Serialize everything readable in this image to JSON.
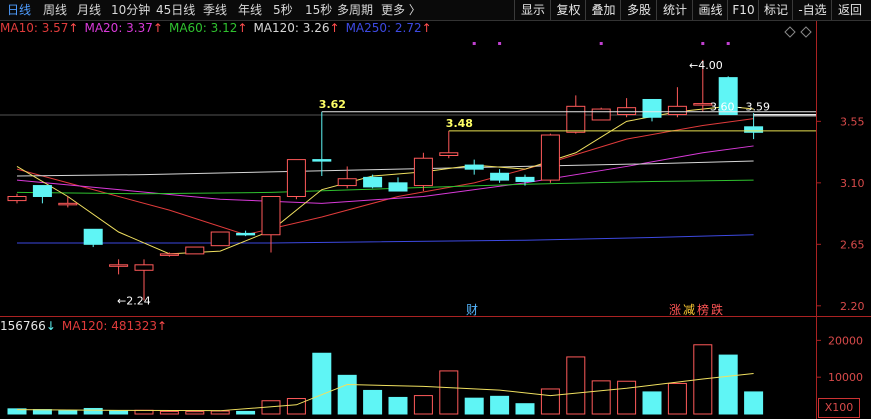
{
  "toolbar": {
    "periods": [
      {
        "label": "日线",
        "active": true
      },
      {
        "label": "周线",
        "active": false
      },
      {
        "label": "月线",
        "active": false
      },
      {
        "label": "10分钟",
        "active": false
      },
      {
        "label": "45日线",
        "active": false
      },
      {
        "label": "季线",
        "active": false
      },
      {
        "label": "年线",
        "active": false
      },
      {
        "label": "5秒",
        "active": false
      },
      {
        "label": "15秒",
        "active": false
      },
      {
        "label": "多周期",
        "active": false
      },
      {
        "label": "更多 〉",
        "active": false
      }
    ],
    "buttons": [
      "显示",
      "复权",
      "叠加",
      "多股",
      "统计",
      "画线",
      "F10",
      "标记",
      "-自选",
      "返回"
    ]
  },
  "ma_legend": [
    {
      "label": "MA10: 3.57",
      "color": "#e03b3b"
    },
    {
      "label": "MA20: 3.37",
      "color": "#d93ad9"
    },
    {
      "label": "MA60: 3.12",
      "color": "#2fc12f"
    },
    {
      "label": "MA120: 3.26",
      "color": "#d6d6d6"
    },
    {
      "label": "MA250: 2.72",
      "color": "#3d49e0"
    }
  ],
  "ma_legend_arrow": "↑",
  "vol_legend": [
    {
      "label": "156766",
      "color": "#e6e6e6",
      "arrow": "↓"
    },
    {
      "label": "MA120: 481323",
      "color": "#e03b3b",
      "arrow": "↑"
    }
  ],
  "price_axis": [
    {
      "value": "3.55",
      "price": 3.55
    },
    {
      "value": "3.10",
      "price": 3.1
    },
    {
      "value": "2.65",
      "price": 2.65
    },
    {
      "value": "2.20",
      "price": 2.2
    }
  ],
  "volume_axis": [
    {
      "value": "20000",
      "vol": 20000
    },
    {
      "value": "10000",
      "vol": 10000
    }
  ],
  "x100_label": "X100",
  "annotations": {
    "high": "4.00",
    "low": "2.24",
    "level_a": "3.62",
    "level_b": "3.48",
    "range": "3.60 - 3.59"
  },
  "badges": {
    "cai": "财",
    "items": [
      {
        "label": "涨",
        "color": "#ff5555"
      },
      {
        "label": "减",
        "color": "#ffcc33"
      },
      {
        "label": "榜",
        "color": "#ff5555"
      },
      {
        "label": "跌",
        "color": "#ff5555"
      }
    ]
  },
  "colors": {
    "up": "#ff5a5a",
    "down": "#5ff5f5",
    "ma5": "#f0e060"
  },
  "chart_data": {
    "type": "candlestick",
    "candles": [
      {
        "o": 2.97,
        "h": 3.02,
        "l": 2.95,
        "c": 3.0
      },
      {
        "o": 3.08,
        "h": 3.08,
        "l": 2.95,
        "c": 3.0
      },
      {
        "o": 2.95,
        "h": 3.0,
        "l": 2.92,
        "c": 2.95
      },
      {
        "o": 2.76,
        "h": 2.76,
        "l": 2.63,
        "c": 2.65
      },
      {
        "o": 2.5,
        "h": 2.54,
        "l": 2.43,
        "c": 2.5
      },
      {
        "o": 2.46,
        "h": 2.54,
        "l": 2.24,
        "c": 2.5
      },
      {
        "o": 2.58,
        "h": 2.59,
        "l": 2.56,
        "c": 2.58
      },
      {
        "o": 2.58,
        "h": 2.63,
        "l": 2.58,
        "c": 2.63
      },
      {
        "o": 2.64,
        "h": 2.74,
        "l": 2.64,
        "c": 2.74
      },
      {
        "o": 2.73,
        "h": 2.75,
        "l": 2.71,
        "c": 2.72
      },
      {
        "o": 2.72,
        "h": 3.0,
        "l": 2.59,
        "c": 3.0
      },
      {
        "o": 3.0,
        "h": 3.27,
        "l": 2.98,
        "c": 3.27
      },
      {
        "o": 3.27,
        "h": 3.62,
        "l": 3.15,
        "c": 3.26
      },
      {
        "o": 3.08,
        "h": 3.22,
        "l": 3.06,
        "c": 3.13
      },
      {
        "o": 3.14,
        "h": 3.16,
        "l": 3.06,
        "c": 3.07
      },
      {
        "o": 3.1,
        "h": 3.14,
        "l": 3.04,
        "c": 3.04
      },
      {
        "o": 3.08,
        "h": 3.32,
        "l": 3.04,
        "c": 3.28
      },
      {
        "o": 3.3,
        "h": 3.48,
        "l": 3.28,
        "c": 3.32
      },
      {
        "o": 3.23,
        "h": 3.27,
        "l": 3.16,
        "c": 3.2
      },
      {
        "o": 3.17,
        "h": 3.2,
        "l": 3.1,
        "c": 3.12
      },
      {
        "o": 3.14,
        "h": 3.16,
        "l": 3.08,
        "c": 3.11
      },
      {
        "o": 3.12,
        "h": 3.46,
        "l": 3.1,
        "c": 3.45
      },
      {
        "o": 3.47,
        "h": 3.74,
        "l": 3.46,
        "c": 3.66
      },
      {
        "o": 3.56,
        "h": 3.65,
        "l": 3.56,
        "c": 3.64
      },
      {
        "o": 3.6,
        "h": 3.72,
        "l": 3.58,
        "c": 3.65
      },
      {
        "o": 3.71,
        "h": 3.71,
        "l": 3.55,
        "c": 3.58
      },
      {
        "o": 3.6,
        "h": 3.8,
        "l": 3.58,
        "c": 3.66
      },
      {
        "o": 3.67,
        "h": 4.0,
        "l": 3.62,
        "c": 3.68
      },
      {
        "o": 3.87,
        "h": 3.88,
        "l": 3.6,
        "c": 3.6
      },
      {
        "o": 3.51,
        "h": 3.61,
        "l": 3.42,
        "c": 3.47
      }
    ],
    "volume": [
      {
        "v": 1400,
        "up": false
      },
      {
        "v": 1200,
        "up": false
      },
      {
        "v": 900,
        "up": false
      },
      {
        "v": 1500,
        "up": false
      },
      {
        "v": 900,
        "up": false
      },
      {
        "v": 1000,
        "up": true
      },
      {
        "v": 700,
        "up": true
      },
      {
        "v": 650,
        "up": true
      },
      {
        "v": 800,
        "up": true
      },
      {
        "v": 700,
        "up": false
      },
      {
        "v": 3600,
        "up": true
      },
      {
        "v": 4200,
        "up": true
      },
      {
        "v": 16500,
        "up": false
      },
      {
        "v": 10500,
        "up": false
      },
      {
        "v": 6400,
        "up": false
      },
      {
        "v": 4500,
        "up": false
      },
      {
        "v": 5000,
        "up": true
      },
      {
        "v": 11700,
        "up": true
      },
      {
        "v": 4300,
        "up": false
      },
      {
        "v": 4800,
        "up": false
      },
      {
        "v": 2800,
        "up": false
      },
      {
        "v": 6800,
        "up": true
      },
      {
        "v": 15500,
        "up": true
      },
      {
        "v": 9000,
        "up": true
      },
      {
        "v": 8900,
        "up": true
      },
      {
        "v": 6000,
        "up": false
      },
      {
        "v": 8300,
        "up": true
      },
      {
        "v": 18800,
        "up": true
      },
      {
        "v": 16000,
        "up": false
      },
      {
        "v": 6000,
        "up": false
      }
    ],
    "ma_lines": [
      {
        "name": "MA10",
        "color": "#e03b3b",
        "points": [
          [
            0,
            3.2
          ],
          [
            3,
            3.05
          ],
          [
            6,
            2.9
          ],
          [
            9,
            2.72
          ],
          [
            12,
            2.85
          ],
          [
            15,
            3.0
          ],
          [
            18,
            3.1
          ],
          [
            21,
            3.25
          ],
          [
            24,
            3.42
          ],
          [
            27,
            3.52
          ],
          [
            29,
            3.57
          ]
        ]
      },
      {
        "name": "MA20",
        "color": "#d93ad9",
        "points": [
          [
            0,
            3.12
          ],
          [
            4,
            3.05
          ],
          [
            8,
            2.98
          ],
          [
            12,
            2.95
          ],
          [
            16,
            3.0
          ],
          [
            20,
            3.1
          ],
          [
            24,
            3.22
          ],
          [
            27,
            3.32
          ],
          [
            29,
            3.37
          ]
        ]
      },
      {
        "name": "MA60",
        "color": "#2fc12f",
        "points": [
          [
            0,
            3.03
          ],
          [
            5,
            3.02
          ],
          [
            10,
            3.03
          ],
          [
            15,
            3.06
          ],
          [
            20,
            3.09
          ],
          [
            25,
            3.11
          ],
          [
            29,
            3.12
          ]
        ]
      },
      {
        "name": "MA120",
        "color": "#d6d6d6",
        "points": [
          [
            0,
            3.15
          ],
          [
            5,
            3.16
          ],
          [
            10,
            3.18
          ],
          [
            15,
            3.2
          ],
          [
            20,
            3.22
          ],
          [
            25,
            3.24
          ],
          [
            29,
            3.26
          ]
        ]
      },
      {
        "name": "MA250",
        "color": "#3d49e0",
        "points": [
          [
            0,
            2.66
          ],
          [
            10,
            2.66
          ],
          [
            20,
            2.68
          ],
          [
            25,
            2.7
          ],
          [
            29,
            2.72
          ]
        ]
      },
      {
        "name": "MA5",
        "color": "#f0e060",
        "points": [
          [
            0,
            3.22
          ],
          [
            2,
            3.0
          ],
          [
            4,
            2.74
          ],
          [
            6,
            2.58
          ],
          [
            8,
            2.6
          ],
          [
            10,
            2.75
          ],
          [
            12,
            3.05
          ],
          [
            14,
            3.15
          ],
          [
            16,
            3.18
          ],
          [
            18,
            3.23
          ],
          [
            20,
            3.2
          ],
          [
            22,
            3.32
          ],
          [
            24,
            3.55
          ],
          [
            26,
            3.62
          ],
          [
            28,
            3.66
          ],
          [
            29,
            3.64
          ]
        ]
      }
    ],
    "vol_ma": [
      [
        0,
        1200
      ],
      [
        4,
        1000
      ],
      [
        8,
        900
      ],
      [
        11,
        2500
      ],
      [
        13,
        8000
      ],
      [
        16,
        7500
      ],
      [
        19,
        6500
      ],
      [
        21,
        5000
      ],
      [
        24,
        7000
      ],
      [
        27,
        9500
      ],
      [
        29,
        11000
      ]
    ],
    "price_range": [
      2.14,
      4.16
    ],
    "vol_range": [
      0,
      22000
    ]
  }
}
